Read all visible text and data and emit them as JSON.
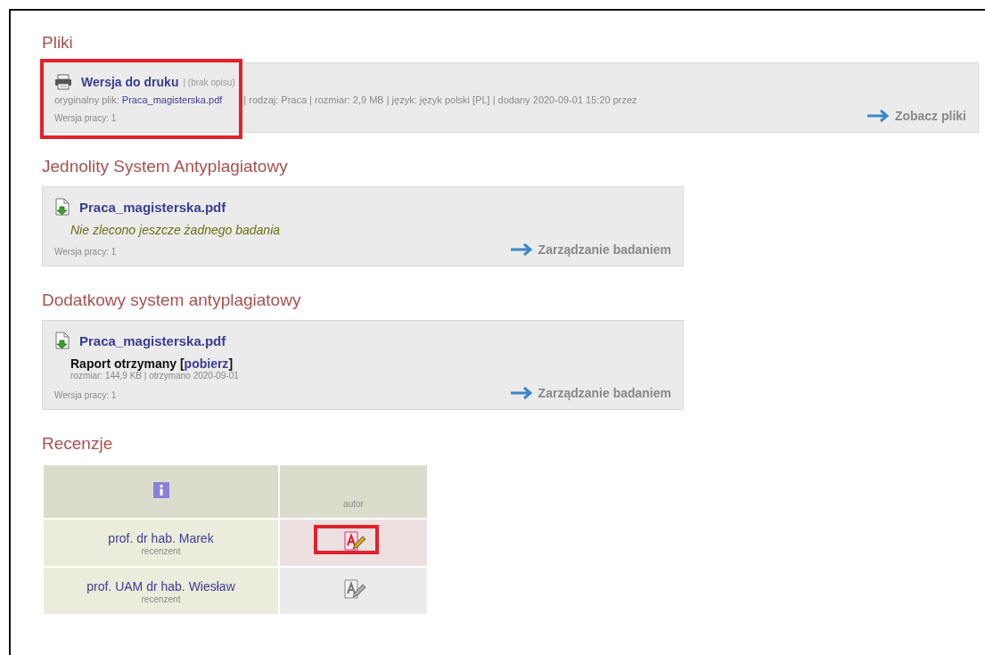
{
  "sections": [
    {
      "title": "Pliki",
      "kind": "files",
      "wide": true,
      "highlighted": true,
      "file": {
        "name": "Wersja do druku",
        "description": "| (brak opisu)"
      },
      "meta": {
        "label": "oryginalny plik:",
        "link": "Praca_magisterska.pdf",
        "rest": "| rodzaj: Praca | rozmiar: 2,9 MB | język: język polski [PL] | dodany 2020-09-01 15:20 przez"
      },
      "version": "Wersja pracy: 1",
      "action": "Zobacz pliki"
    },
    {
      "title": "Jednolity System Antyplagiatowy",
      "kind": "plagiarism",
      "wide": false,
      "highlighted": false,
      "file": {
        "name": "Praca_magisterska.pdf"
      },
      "status": "Nie zlecono jeszcze żadnego badania",
      "version": "Wersja pracy: 1",
      "action": "Zarządzanie badaniem"
    },
    {
      "title": "Dodatkowy system antyplagiatowy",
      "kind": "report",
      "wide": false,
      "highlighted": false,
      "file": {
        "name": "Praca_magisterska.pdf"
      },
      "report": {
        "label": "Raport otrzymany",
        "link": "pobierz",
        "brackets": [
          "[",
          "]"
        ],
        "details": "rozmiar: 144,9 KB | otrzymano 2020-09-01"
      },
      "version": "Wersja pracy: 1",
      "action": "Zarządzanie badaniem"
    }
  ],
  "reviews": {
    "title": "Recenzje",
    "columns": [
      "autor"
    ],
    "rows": [
      {
        "name": "prof. dr hab. Marek",
        "role": "recenzent",
        "active": true,
        "highlighted": true
      },
      {
        "name": "prof. UAM dr hab. Wiesław",
        "role": "recenzent",
        "active": false,
        "highlighted": false
      }
    ]
  }
}
